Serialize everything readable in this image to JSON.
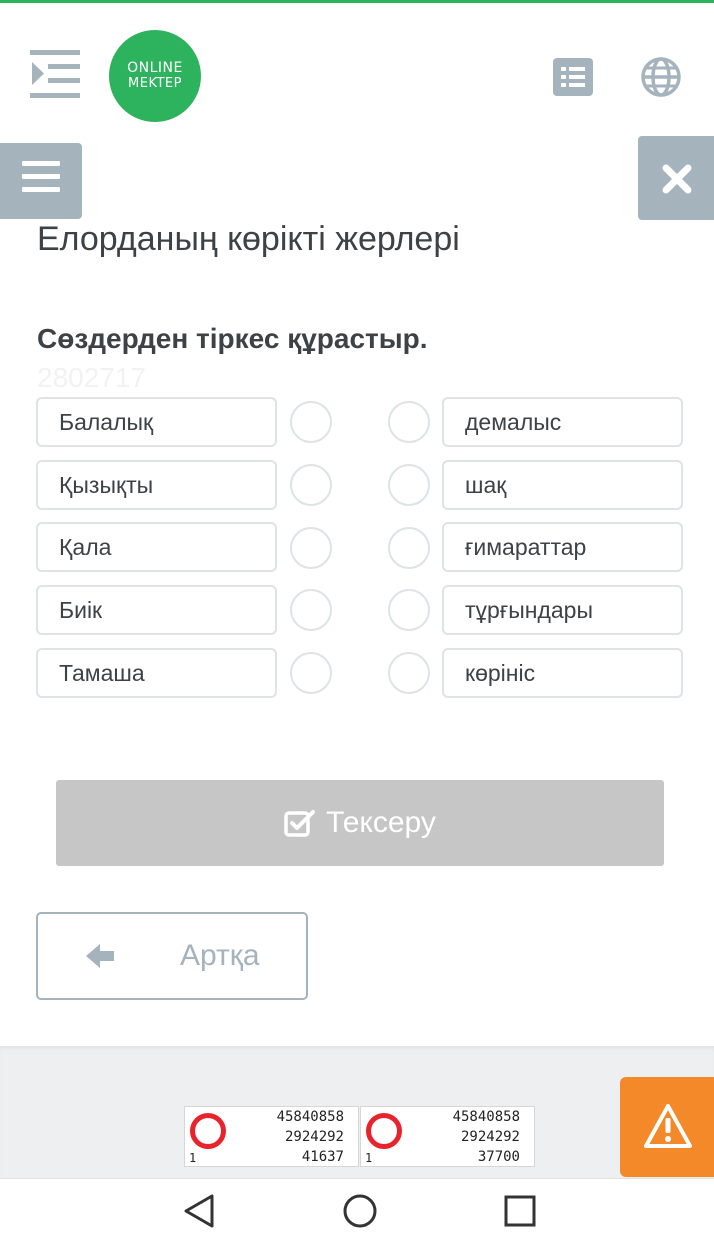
{
  "header": {
    "logo_line1": "ONLINE",
    "logo_line2": "MEKTEP",
    "accent_color": "#2db35d",
    "icons": [
      "indent-menu-icon",
      "list-icon",
      "globe-icon"
    ]
  },
  "panel": {
    "menu_icon": "hamburger-icon",
    "close_icon": "close-icon",
    "button_color": "#a5b3bd"
  },
  "lesson": {
    "title": "Елорданың көрікті жерлері",
    "task": "Сөздерден тіркес құрастыр.",
    "task_id": "2802717"
  },
  "matching": {
    "left": [
      {
        "label": "Балалық"
      },
      {
        "label": "Қызықты"
      },
      {
        "label": "Қала"
      },
      {
        "label": "Биік"
      },
      {
        "label": "Тамаша"
      }
    ],
    "right": [
      {
        "label": "демалыс"
      },
      {
        "label": "шақ"
      },
      {
        "label": "ғимараттар"
      },
      {
        "label": "тұрғындары"
      },
      {
        "label": "көрініс"
      }
    ]
  },
  "actions": {
    "check_label": "Тексеру",
    "check_icon": "checkbox-edit-icon",
    "back_label": "Артқа",
    "back_icon": "arrow-left-icon"
  },
  "footer": {
    "badges": [
      {
        "n1": "45840858",
        "n2": "2924292",
        "n3": "41637",
        "n0": "1"
      },
      {
        "n1": "45840858",
        "n2": "2924292",
        "n3": "37700",
        "n0": "1"
      }
    ],
    "warn_icon": "warning-icon",
    "warn_color": "#f4892a"
  },
  "system_nav": [
    "back-triangle-icon",
    "home-circle-icon",
    "recents-square-icon"
  ]
}
